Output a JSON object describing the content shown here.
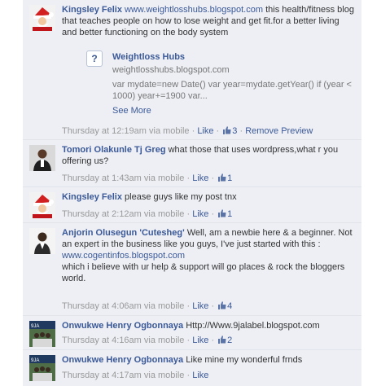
{
  "comments": [
    {
      "author": "Kingsley Felix",
      "link": "www.weightlosshubs.blogspot.com",
      "text": " this health/fitness blog that teaches people on how to lose weight and get fit.for a better living and better functioning on the body system",
      "time": "Thursday at 12:19am",
      "via": " via mobile · ",
      "like": "Like",
      "like_count": "3",
      "extra": "Remove Preview",
      "avatar_icon": "santa-avatar-icon",
      "preview": {
        "icon": "?",
        "title": "Weightloss Hubs",
        "domain": "weightlosshubs.blogspot.com",
        "description": "var mydate=new Date() var year=mydate.getYear() if (year < 1000) year+=1900 var...",
        "more": "See More"
      }
    },
    {
      "author": "Tomori Olakunle Tj Greg",
      "text": " what those that uses wordpress,what r you offering us?",
      "time": "Thursday at 1:43am",
      "via": " via mobile · ",
      "like": "Like",
      "like_count": "1",
      "avatar_icon": "person-avatar-icon"
    },
    {
      "author": "Kingsley Felix",
      "text": " please guys like my post tnx",
      "time": "Thursday at 2:12am",
      "via": " via mobile · ",
      "like": "Like",
      "like_count": "1",
      "avatar_icon": "santa-avatar-icon"
    },
    {
      "author": "Anjorin Olusegun 'Cutesheg'",
      "text": " Well, am a newbie here & a beginner. Not an expert in the business like you guys, I've just started with this :",
      "link": "www.cogentinfos.blogspot.com",
      "text2": "which i believe with ur help & support will go places & rock the bloggers world.",
      "time": "Thursday at 4:06am",
      "via": " via mobile · ",
      "like": "Like",
      "like_count": "4",
      "avatar_icon": "person-avatar-icon"
    },
    {
      "author": "Onwukwe Henry Ogbonnaya",
      "text": " Http://Www.9jalabel.blogspot.com",
      "time": "Thursday at 4:16am",
      "via": " via mobile · ",
      "like": "Like",
      "like_count": "2",
      "avatar_icon": "group-avatar-icon"
    },
    {
      "author": "Onwukwe Henry Ogbonnaya",
      "text": " Like mine my wonderful frnds",
      "time": "Thursday at 4:17am",
      "via": " via mobile · ",
      "like": "Like",
      "avatar_icon": "group-avatar-icon"
    }
  ],
  "colors": {
    "background": "#edeff4",
    "link": "#3b5998",
    "meta": "#999999"
  }
}
